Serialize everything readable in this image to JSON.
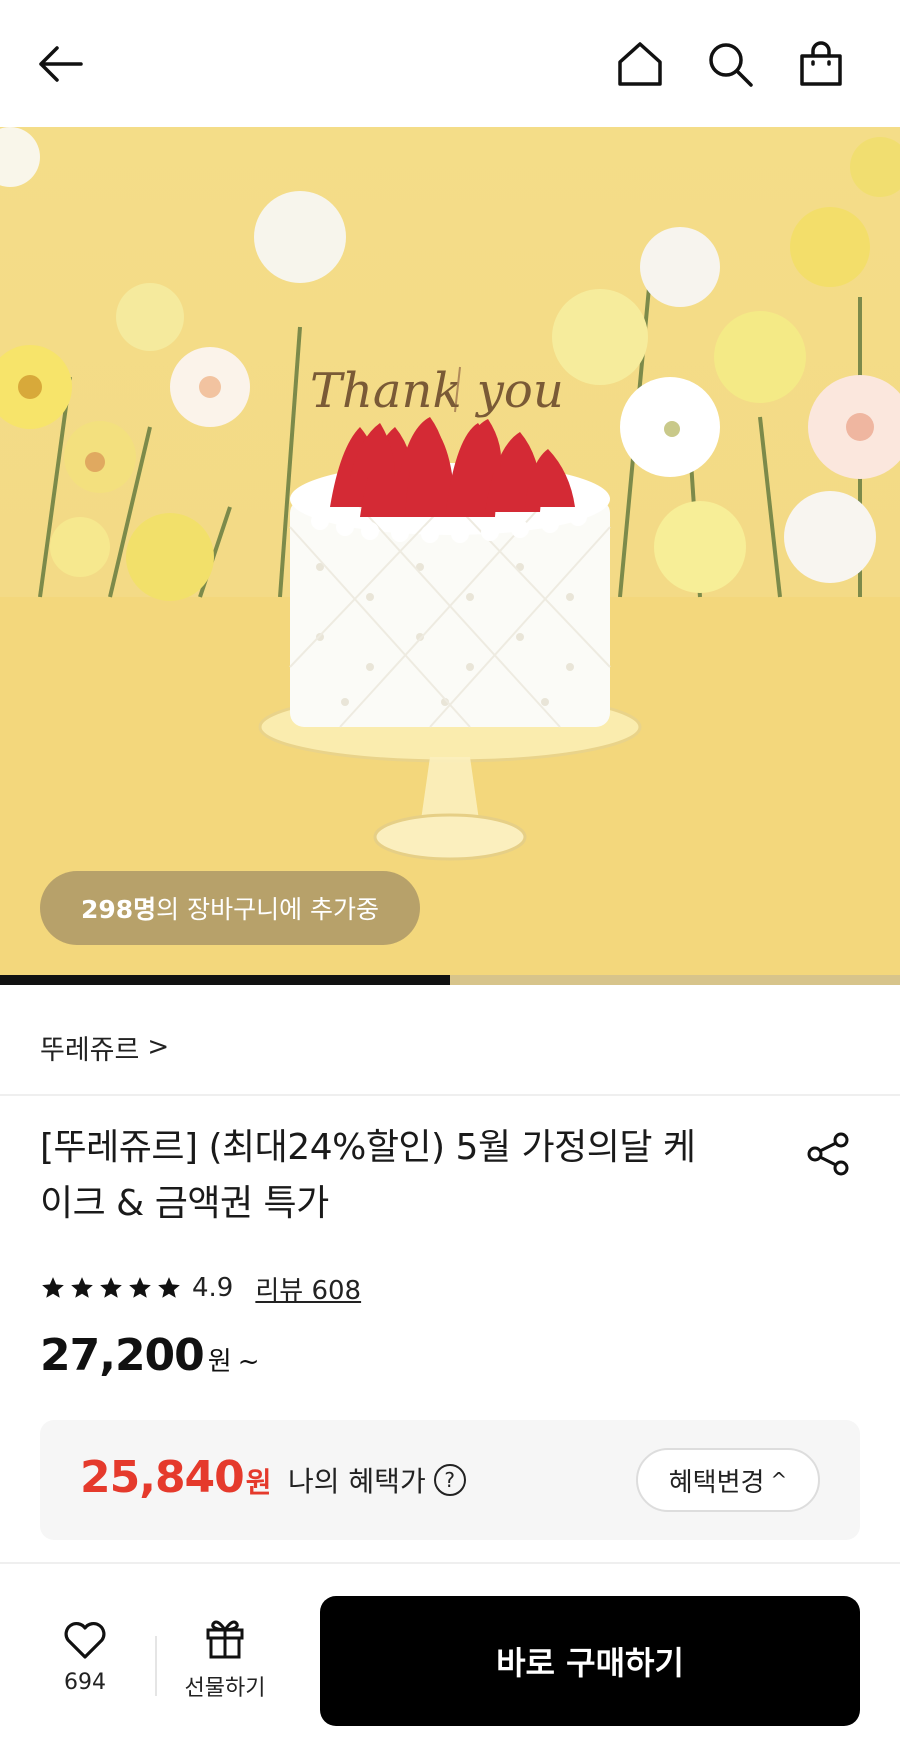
{
  "header": {
    "icons": [
      "arrow-left-icon",
      "home-icon",
      "search-icon",
      "shopping-bag-icon"
    ]
  },
  "hero": {
    "topper_text": "Thank you",
    "cart_pill": {
      "count": "298명",
      "text": "의 장바구니에 추가중"
    },
    "slide_progress": 0.5
  },
  "product": {
    "brand": "뚜레쥬르",
    "brand_chevron": ">",
    "title_line1": "[뚜레쥬르] (최대24%할인) 5월 가정의달 케",
    "title_line2": "이크 & 금액권 특가",
    "rating": "4.9",
    "stars": 5,
    "review_link": "리뷰 608",
    "price": "27,200",
    "price_unit": "원",
    "price_suffix": "~"
  },
  "benefit": {
    "price": "25,840",
    "unit": "원",
    "label": "나의 혜택가",
    "help_icon": "?",
    "change_button": "혜택변경",
    "change_caret": "^"
  },
  "bottom_bar": {
    "like_count": "694",
    "gift_label": "선물하기",
    "buy_label": "바로 구매하기"
  },
  "colors": {
    "accent_price": "#e53a2c",
    "buy_button": "#000000",
    "hero_bg": "#f3da86"
  }
}
